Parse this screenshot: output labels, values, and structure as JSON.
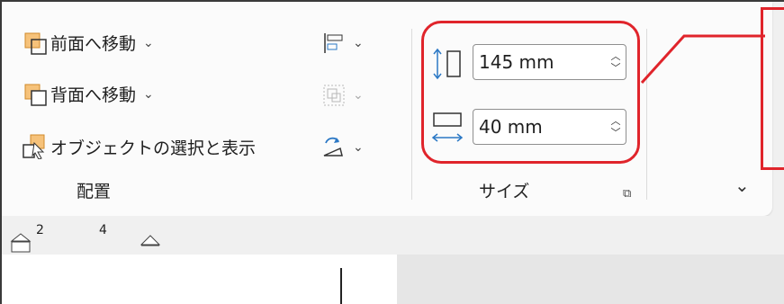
{
  "arrange_group": {
    "label": "配置",
    "bring_forward": {
      "label": "前面へ移動",
      "icon": "bring-forward-icon"
    },
    "send_backward": {
      "label": "背面へ移動",
      "icon": "send-backward-icon"
    },
    "selection_pane": {
      "label": "オブジェクトの選択と表示",
      "icon": "selection-pane-icon"
    }
  },
  "size_group": {
    "label": "サイズ",
    "height": {
      "value": "145 mm",
      "icon": "shape-height-icon"
    },
    "width": {
      "value": "40 mm",
      "icon": "shape-width-icon"
    }
  },
  "ruler": {
    "marks": [
      "2",
      "4"
    ]
  },
  "colors": {
    "callout": "#e0242b",
    "icon_orange": "#f2a03d",
    "icon_blue": "#2b78c5"
  }
}
